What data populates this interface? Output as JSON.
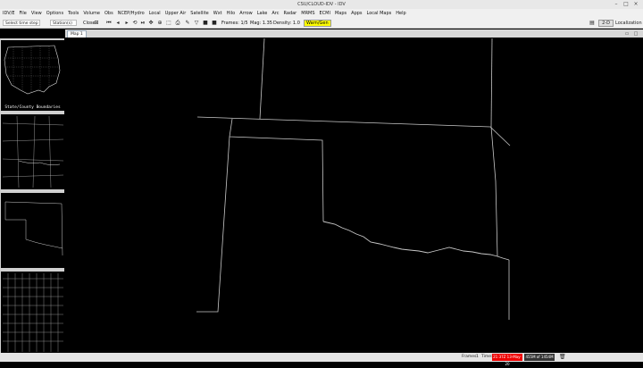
{
  "window": {
    "title": "CSU/CLOUD-IDV - IDV"
  },
  "menu": [
    "IDV/E",
    "File",
    "View",
    "Options",
    "Tools",
    "Volume",
    "Obs",
    "NCEP/Hydro",
    "Local",
    "Upper Air",
    "Satellite",
    "Wxt",
    "Hilo",
    "Arrow",
    "Lake",
    "Arc",
    "Radar",
    "MRMS",
    "ECMI",
    "Maps",
    "Apps",
    "Local Maps",
    "Help"
  ],
  "toolbar": {
    "time_select": "Select time step",
    "zoom_select": "Station(s)",
    "close_label": "Close",
    "frames_label": "Frames: 1/5",
    "mag_label": "Mag: 1.35",
    "density_label": "Density: 1.0",
    "warning_label": "Warn/Gen",
    "mode_label": "2-D",
    "localization_label": "Localization"
  },
  "panels": [
    {
      "label": "State/County Boundaries"
    },
    {
      "label": ""
    },
    {
      "label": ""
    },
    {
      "label": ""
    }
  ],
  "tab": {
    "label": "Map 1"
  },
  "status": {
    "frames_label": "Frames:",
    "frames_value": "1",
    "time_label": "Time:",
    "time_value": "21:37Z 13-May-20",
    "memory_value": "455M of 1454M"
  }
}
